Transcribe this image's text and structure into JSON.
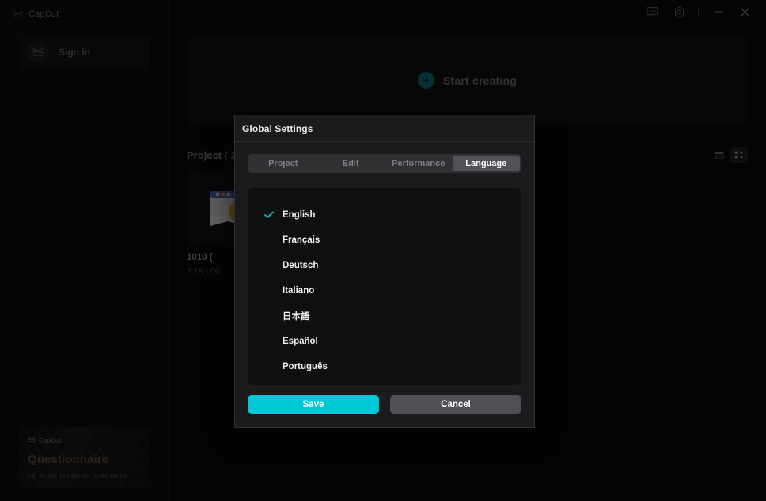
{
  "sidebar": {
    "brand": "CapCut",
    "brand_icon": "capcut-logo-icon",
    "signin_label": "Sign in",
    "signin_avatar_icon": "capcut-avatar-icon",
    "questionnaire": {
      "brand": "CapCut",
      "title": "Questionnaire",
      "subtitle": "Fill in this to help us to do better"
    }
  },
  "titlebar": {
    "buttons": [
      {
        "name": "feedback-icon",
        "glyph": "feedback"
      },
      {
        "name": "settings-gear-icon",
        "glyph": "gear"
      },
      {
        "name": "minimize-button",
        "glyph": "minimize"
      },
      {
        "name": "close-button",
        "glyph": "close"
      }
    ]
  },
  "main": {
    "start_creating_label": "Start creating",
    "start_creating_icon": "plus-circle-icon",
    "project_section_title": "Project ( 2",
    "view_list_icon": "list-view-icon",
    "view_grid_icon": "grid-view-icon",
    "card": {
      "name": "1010 (",
      "meta": "3.1K | 00"
    }
  },
  "modal": {
    "title": "Global Settings",
    "tabs": [
      {
        "label": "Project",
        "active": false
      },
      {
        "label": "Edit",
        "active": false
      },
      {
        "label": "Performance",
        "active": false
      },
      {
        "label": "Language",
        "active": true
      }
    ],
    "languages": [
      {
        "label": "English",
        "selected": true
      },
      {
        "label": "Français",
        "selected": false
      },
      {
        "label": "Deutsch",
        "selected": false
      },
      {
        "label": "Italiano",
        "selected": false
      },
      {
        "label": "日本語",
        "selected": false
      },
      {
        "label": "Español",
        "selected": false
      },
      {
        "label": "Português",
        "selected": false
      }
    ],
    "save_label": "Save",
    "cancel_label": "Cancel"
  },
  "colors": {
    "accent": "#00c8d7",
    "modal_bg": "#1b1b1d",
    "app_bg": "#0a0a0b"
  }
}
